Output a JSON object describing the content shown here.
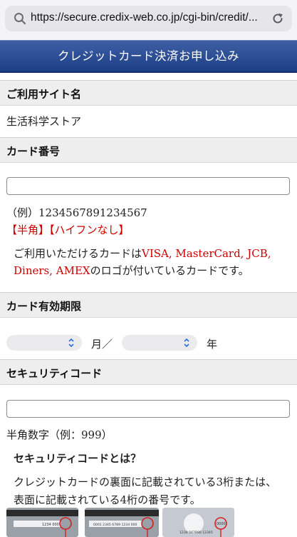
{
  "browser": {
    "url": "https://secure.credix-web.co.jp/cgi-bin/credit/..."
  },
  "header": {
    "title": "クレジットカード決済お申し込み"
  },
  "site": {
    "heading": "ご利用サイト名",
    "name": "生活科学ストア"
  },
  "card_number": {
    "heading": "カード番号",
    "value": "",
    "example": "（例）1234567891234567",
    "note": "【半角】【ハイフンなし】",
    "brands_line1_prefix": "ご利用いただけるカードは",
    "brands_line1_red": "VISA, MasterCard, JCB,",
    "brands_line2_red": "Diners, AMEX",
    "brands_line2_suffix": "のロゴが付いているカードです。"
  },
  "expiry": {
    "heading": "カード有効期限",
    "month_value": "",
    "month_label": "月／",
    "year_value": "",
    "year_label": "年"
  },
  "security": {
    "heading": "セキュリティコード",
    "value": "",
    "hint": "半角数字（例：999）",
    "what_title": "セキュリティコードとは？",
    "desc_line1": "クレジットカードの裏面に記載されている3桁または、",
    "desc_line2": "表面に記載されている4桁の番号です。",
    "card1_text": "1234 000",
    "card2_text": "0001 2345 6789 1234 000",
    "card3_text": "1234 567890 12345",
    "card3_code": "0000"
  },
  "colors": {
    "header_blue": "#1d3f86",
    "accent_red": "#cc0000",
    "section_gray": "#eeeeee"
  },
  "icons": [
    "search-icon",
    "reload-icon",
    "chevron-updown-icon"
  ]
}
